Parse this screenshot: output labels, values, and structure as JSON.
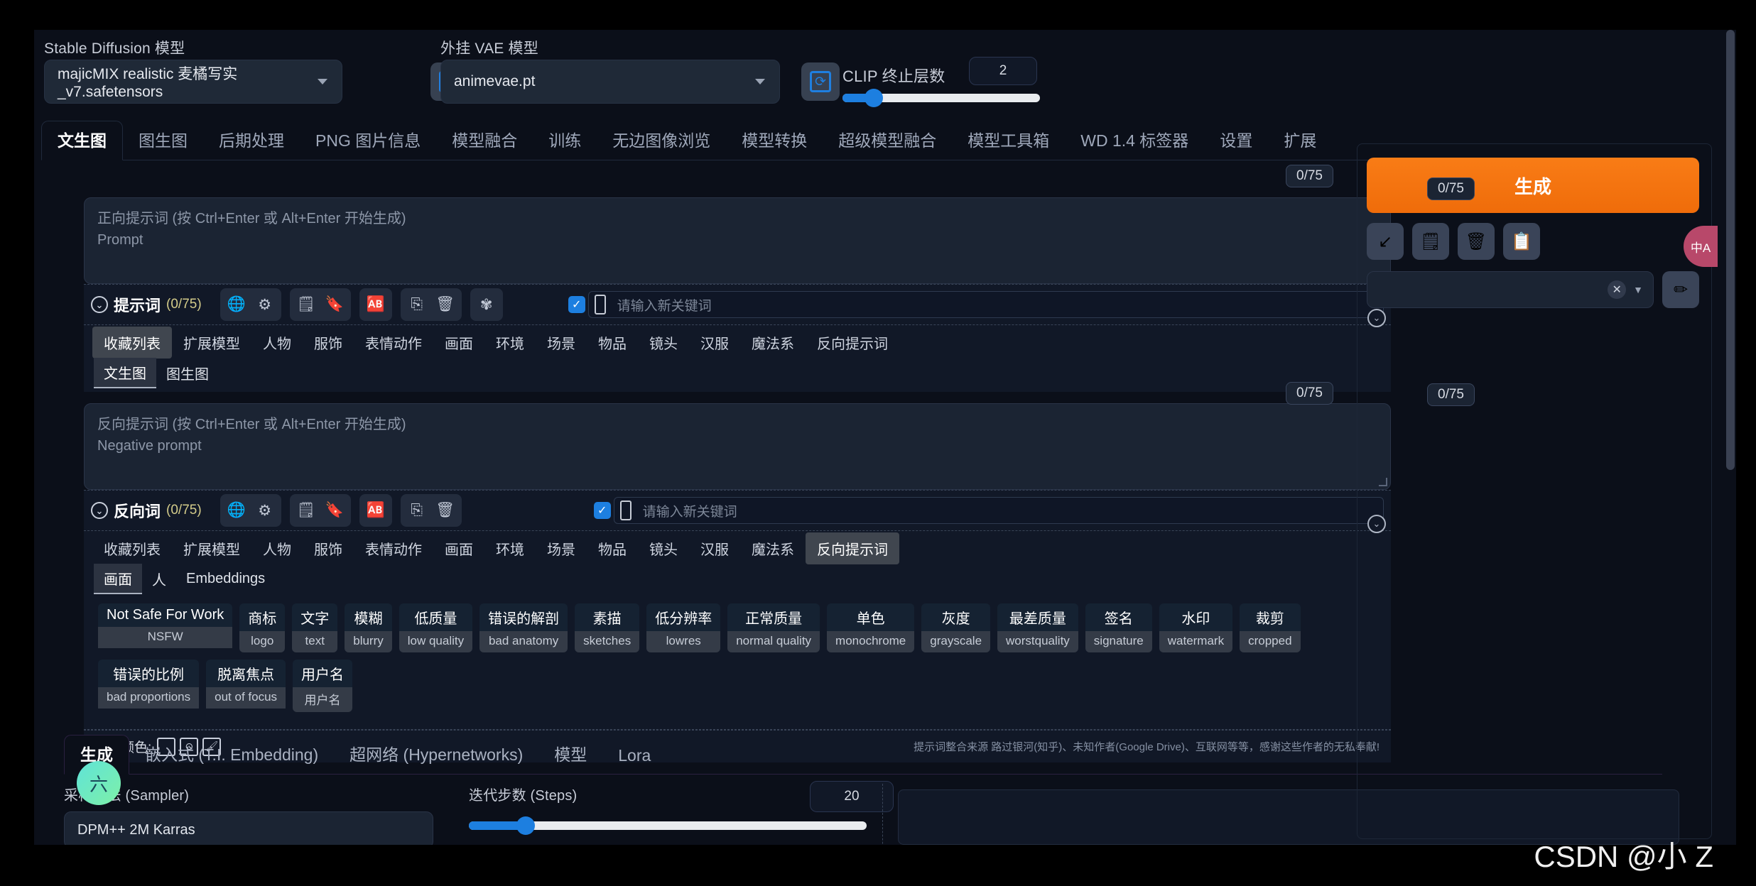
{
  "header": {
    "sd_model_label": "Stable Diffusion 模型",
    "sd_model_value": "majicMIX realistic 麦橘写实_v7.safetensors",
    "vae_label": "外挂 VAE 模型",
    "vae_value": "animevae.pt",
    "clip_label": "CLIP 终止层数",
    "clip_value": "2",
    "refresh_icon": "refresh-icon"
  },
  "main_tabs": [
    {
      "label": "文生图",
      "active": true
    },
    {
      "label": "图生图",
      "active": false
    },
    {
      "label": "后期处理",
      "active": false
    },
    {
      "label": "PNG 图片信息",
      "active": false
    },
    {
      "label": "模型融合",
      "active": false
    },
    {
      "label": "训练",
      "active": false
    },
    {
      "label": "无边图像浏览",
      "active": false
    },
    {
      "label": "模型转换",
      "active": false
    },
    {
      "label": "超级模型融合",
      "active": false
    },
    {
      "label": "模型工具箱",
      "active": false
    },
    {
      "label": "WD 1.4 标签器",
      "active": false
    },
    {
      "label": "设置",
      "active": false
    },
    {
      "label": "扩展",
      "active": false
    }
  ],
  "prompt": {
    "placeholder_cn": "正向提示词 (按 Ctrl+Enter 或 Alt+Enter 开始生成)",
    "placeholder_en": "Prompt",
    "token_count": "0/75"
  },
  "negative_prompt": {
    "placeholder_cn": "反向提示词 (按 Ctrl+Enter 或 Alt+Enter 开始生成)",
    "placeholder_en": "Negative prompt",
    "token_count": "0/75"
  },
  "prompt_toolbar": {
    "title": "提示词",
    "count": "(0/75)",
    "icons": [
      "globe-icon",
      "gear-icon",
      "history-icon",
      "bookmark-icon",
      "translate-ab-icon",
      "copy-icon",
      "trash-icon",
      "openai-icon"
    ],
    "keyword_placeholder": "请输入新关键词",
    "checkbox_checked": true
  },
  "negative_toolbar": {
    "title": "反向词",
    "count": "(0/75)",
    "icons": [
      "globe-icon",
      "gear-icon",
      "history-icon",
      "bookmark-icon",
      "translate-ab-icon",
      "copy-icon",
      "trash-icon"
    ],
    "keyword_placeholder": "请输入新关键词",
    "checkbox_checked": true
  },
  "category_tabs": [
    {
      "label": "收藏列表"
    },
    {
      "label": "扩展模型"
    },
    {
      "label": "人物"
    },
    {
      "label": "服饰"
    },
    {
      "label": "表情动作"
    },
    {
      "label": "画面"
    },
    {
      "label": "环境"
    },
    {
      "label": "场景"
    },
    {
      "label": "物品"
    },
    {
      "label": "镜头"
    },
    {
      "label": "汉服"
    },
    {
      "label": "魔法系"
    },
    {
      "label": "反向提示词"
    }
  ],
  "prompt_category_active": "收藏列表",
  "negative_category_active": "反向提示词",
  "prompt_subtabs": [
    {
      "label": "文生图",
      "active": true
    },
    {
      "label": "图生图",
      "active": false
    }
  ],
  "negative_subtabs": [
    {
      "label": "画面",
      "active": true
    },
    {
      "label": "人",
      "active": false
    },
    {
      "label": "Embeddings",
      "active": false
    }
  ],
  "negative_tags_row1": [
    {
      "cn": "Not Safe For Work",
      "en": "NSFW"
    },
    {
      "cn": "商标",
      "en": "logo"
    },
    {
      "cn": "文字",
      "en": "text"
    },
    {
      "cn": "模糊",
      "en": "blurry"
    },
    {
      "cn": "低质量",
      "en": "low quality"
    },
    {
      "cn": "错误的解剖",
      "en": "bad anatomy"
    },
    {
      "cn": "素描",
      "en": "sketches"
    },
    {
      "cn": "低分辨率",
      "en": "lowres"
    },
    {
      "cn": "正常质量",
      "en": "normal quality"
    },
    {
      "cn": "单色",
      "en": "monochrome"
    },
    {
      "cn": "灰度",
      "en": "grayscale"
    },
    {
      "cn": "最差质量",
      "en": "worstquality"
    },
    {
      "cn": "签名",
      "en": "signature"
    },
    {
      "cn": "水印",
      "en": "watermark"
    },
    {
      "cn": "裁剪",
      "en": "cropped"
    }
  ],
  "negative_tags_row2": [
    {
      "cn": "错误的比例",
      "en": "bad proportions"
    },
    {
      "cn": "脱离焦点",
      "en": "out of focus"
    },
    {
      "cn": "用户名",
      "en": "用户名"
    }
  ],
  "tag_color_row": {
    "label": "标签颜色:",
    "buttons": [
      "color-swatch-icon",
      "reset-icon",
      "brush-icon"
    ],
    "credit": "提示词整合来源 路过银河(知乎)、未知作者(Google Drive)、互联网等等，感谢这些作者的无私奉献!"
  },
  "generation_tabs": [
    {
      "label": "生成",
      "active": true
    },
    {
      "label": "嵌入式 (T.I. Embedding)",
      "active": false
    },
    {
      "label": "超网络 (Hypernetworks)",
      "active": false
    },
    {
      "label": "模型",
      "active": false
    },
    {
      "label": "Lora",
      "active": false
    }
  ],
  "avatar_text": "六",
  "sampler": {
    "label": "采样方法 (Sampler)",
    "value": "DPM++ 2M Karras"
  },
  "steps": {
    "label": "迭代步数 (Steps)",
    "value": "20"
  },
  "right_panel": {
    "generate_label": "生成",
    "action_icons": [
      "arrow-down-left-icon",
      "notepad-icon",
      "trash-bin-icon",
      "clipboard-icon"
    ],
    "style_clear_icon": "clear-x-icon",
    "style_caret_icon": "chevron-down-icon",
    "pen_icon": "pencil-icon"
  },
  "translate_pill": "中A",
  "watermark": "CSDN @小 Z"
}
